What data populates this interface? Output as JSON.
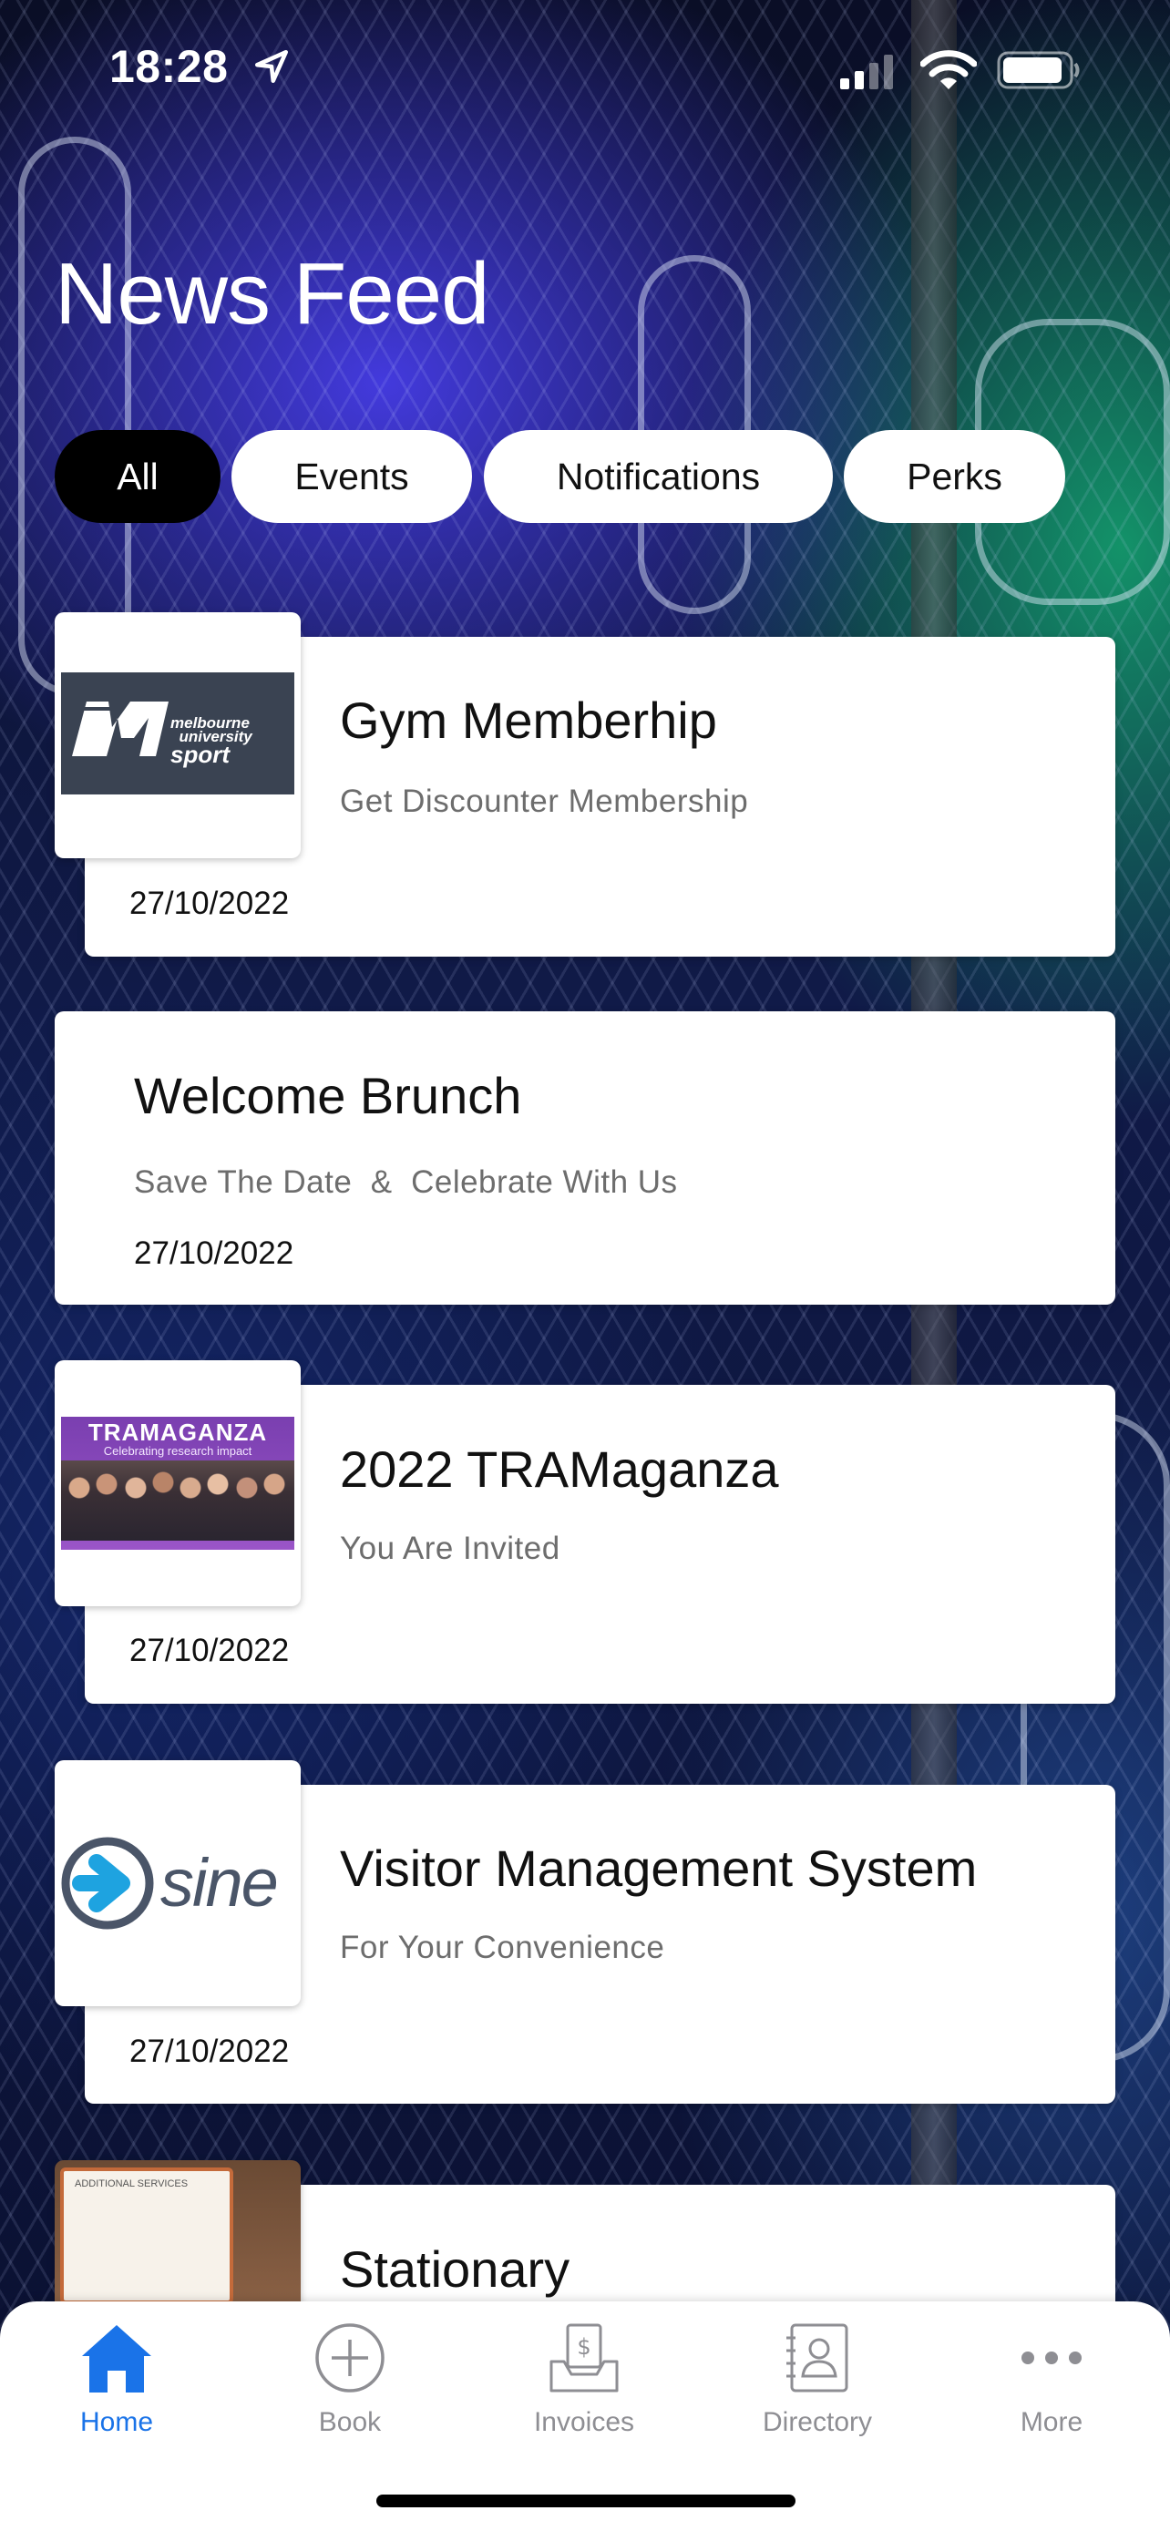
{
  "status_bar": {
    "time": "18:28"
  },
  "page_title": "News Feed",
  "filters": [
    {
      "label": "All",
      "active": true
    },
    {
      "label": "Events",
      "active": false
    },
    {
      "label": "Notifications",
      "active": false
    },
    {
      "label": "Perks",
      "active": false
    }
  ],
  "feed": [
    {
      "title": "Gym Memberhip",
      "subtitle": "Get Discounter Membership",
      "date": "27/10/2022",
      "thumbnail_logo_text": "melbourne university sport"
    },
    {
      "title": "Welcome Brunch",
      "subtitle": "Save The Date  &  Celebrate With Us",
      "date": "27/10/2022"
    },
    {
      "title": "2022 TRAMaganza",
      "subtitle": "You Are Invited",
      "date": "27/10/2022",
      "thumbnail_banner_text": "TRAMAGANZA",
      "thumbnail_banner_sub": "Celebrating research impact"
    },
    {
      "title": "Visitor Management System",
      "subtitle": "For Your Convenience",
      "date": "27/10/2022",
      "thumbnail_logo_text": "sine"
    },
    {
      "title": "Stationary",
      "thumbnail_sign_text": "ADDITIONAL SERVICES"
    }
  ],
  "tabs": [
    {
      "label": "Home",
      "icon": "home-icon",
      "active": true
    },
    {
      "label": "Book",
      "icon": "plus-circle-icon",
      "active": false
    },
    {
      "label": "Invoices",
      "icon": "invoice-tray-icon",
      "active": false
    },
    {
      "label": "Directory",
      "icon": "contact-book-icon",
      "active": false
    },
    {
      "label": "More",
      "icon": "more-dots-icon",
      "active": false
    }
  ],
  "colors": {
    "accent": "#1a73e8",
    "inactive_tab": "#8e8e93",
    "chip_active_bg": "#000000",
    "chip_bg": "#ffffff"
  }
}
